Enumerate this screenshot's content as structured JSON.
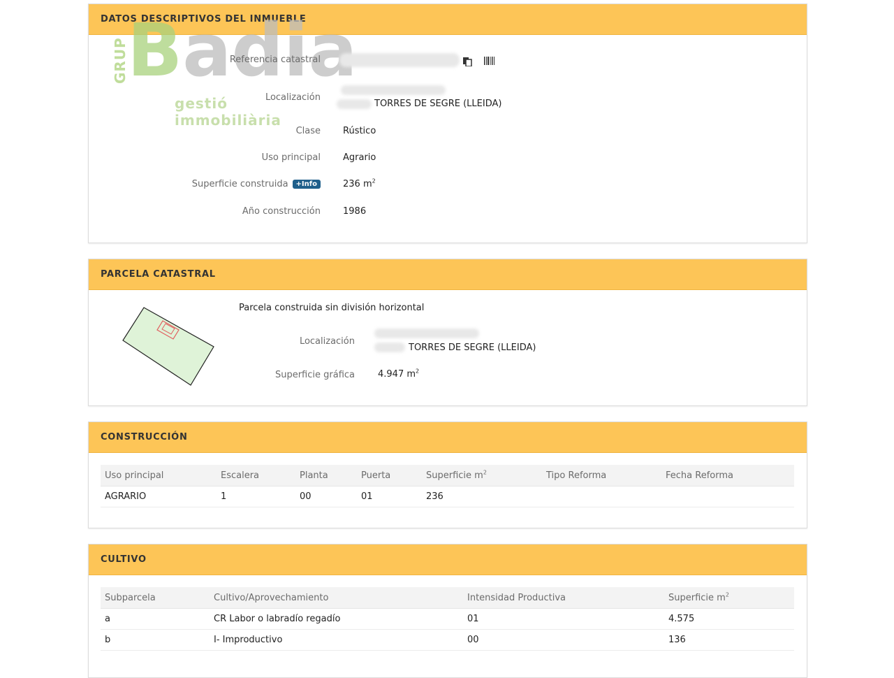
{
  "datos": {
    "title": "DATOS DESCRIPTIVOS DEL INMUEBLE",
    "ref_label": "Referencia catastral",
    "loc_label": "Localización",
    "loc_value": "TORRES DE SEGRE (LLEIDA)",
    "clase_label": "Clase",
    "clase_value": "Rústico",
    "uso_label": "Uso principal",
    "uso_value": "Agrario",
    "sup_label": "Superficie construida",
    "info_badge": "+Info",
    "sup_value": "236 m",
    "sup_unit_exp": "2",
    "anio_label": "Año construcción",
    "anio_value": "1986"
  },
  "logo": {
    "grup": "GRUP",
    "big_first": "B",
    "big_rest": "adia",
    "sub": "gestió immobiliària"
  },
  "parcela": {
    "title": "PARCELA CATASTRAL",
    "desc": "Parcela construida sin división horizontal",
    "loc_label": "Localización",
    "loc_value": "TORRES DE SEGRE (LLEIDA)",
    "sup_label": "Superficie gráfica",
    "sup_value": "4.947 m",
    "sup_unit_exp": "2"
  },
  "construccion": {
    "title": "CONSTRUCCIÓN",
    "headers": [
      "Uso principal",
      "Escalera",
      "Planta",
      "Puerta",
      "Superficie m",
      "Tipo Reforma",
      "Fecha Reforma"
    ],
    "sup_exp": "2",
    "rows": [
      [
        "AGRARIO",
        "1",
        "00",
        "01",
        "236",
        "",
        ""
      ]
    ]
  },
  "cultivo": {
    "title": "CULTIVO",
    "headers": [
      "Subparcela",
      "Cultivo/Aprovechamiento",
      "Intensidad Productiva",
      "Superficie m"
    ],
    "sup_exp": "2",
    "rows": [
      [
        "a",
        "CR Labor o labradío regadío",
        "01",
        "4.575"
      ],
      [
        "b",
        "I- Improductivo",
        "00",
        "136"
      ]
    ]
  },
  "colors": {
    "header_bg": "#fdc557",
    "badge_bg": "#1f5f8b",
    "parcel_fill": "#dff3d8",
    "building_outline": "#e06060"
  }
}
